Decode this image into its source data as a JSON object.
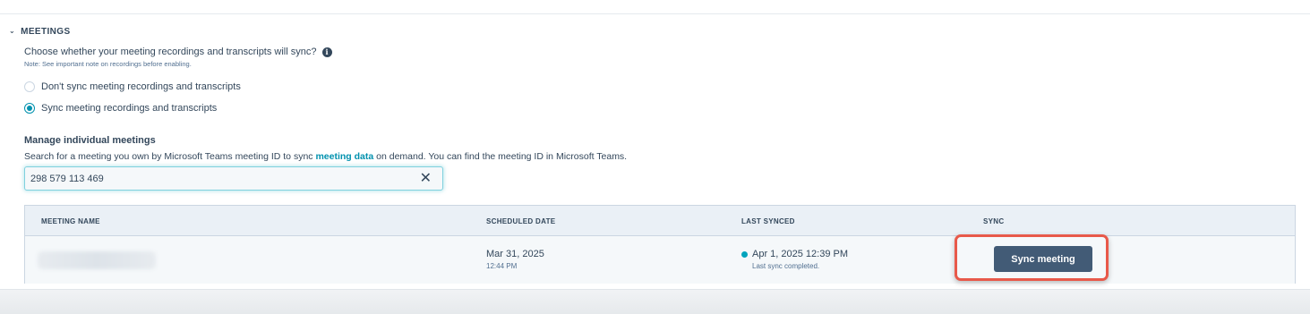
{
  "section": {
    "title": "MEETINGS",
    "question": "Choose whether your meeting recordings and transcripts will sync?",
    "note": "Note: See important note on recordings before enabling.",
    "options": [
      {
        "label": "Don't sync meeting recordings and transcripts",
        "checked": false
      },
      {
        "label": "Sync meeting recordings and transcripts",
        "checked": true
      }
    ]
  },
  "manage": {
    "title": "Manage individual meetings",
    "desc_before": "Search for a meeting you own by Microsoft Teams meeting ID to sync ",
    "desc_link": "meeting data",
    "desc_after": " on demand. You can find the meeting ID in Microsoft Teams.",
    "search_value": "298 579 113 469"
  },
  "table": {
    "headers": {
      "name": "MEETING NAME",
      "date": "SCHEDULED DATE",
      "last_synced": "LAST SYNCED",
      "sync": "SYNC"
    },
    "rows": [
      {
        "date": "Mar 31, 2025",
        "time": "12:44 PM",
        "last_synced": "Apr 1, 2025 12:39 PM",
        "status": "Last sync completed.",
        "button": "Sync meeting"
      }
    ]
  },
  "colors": {
    "accent": "#0091ae",
    "button": "#425b76",
    "highlight": "#e8594a"
  }
}
